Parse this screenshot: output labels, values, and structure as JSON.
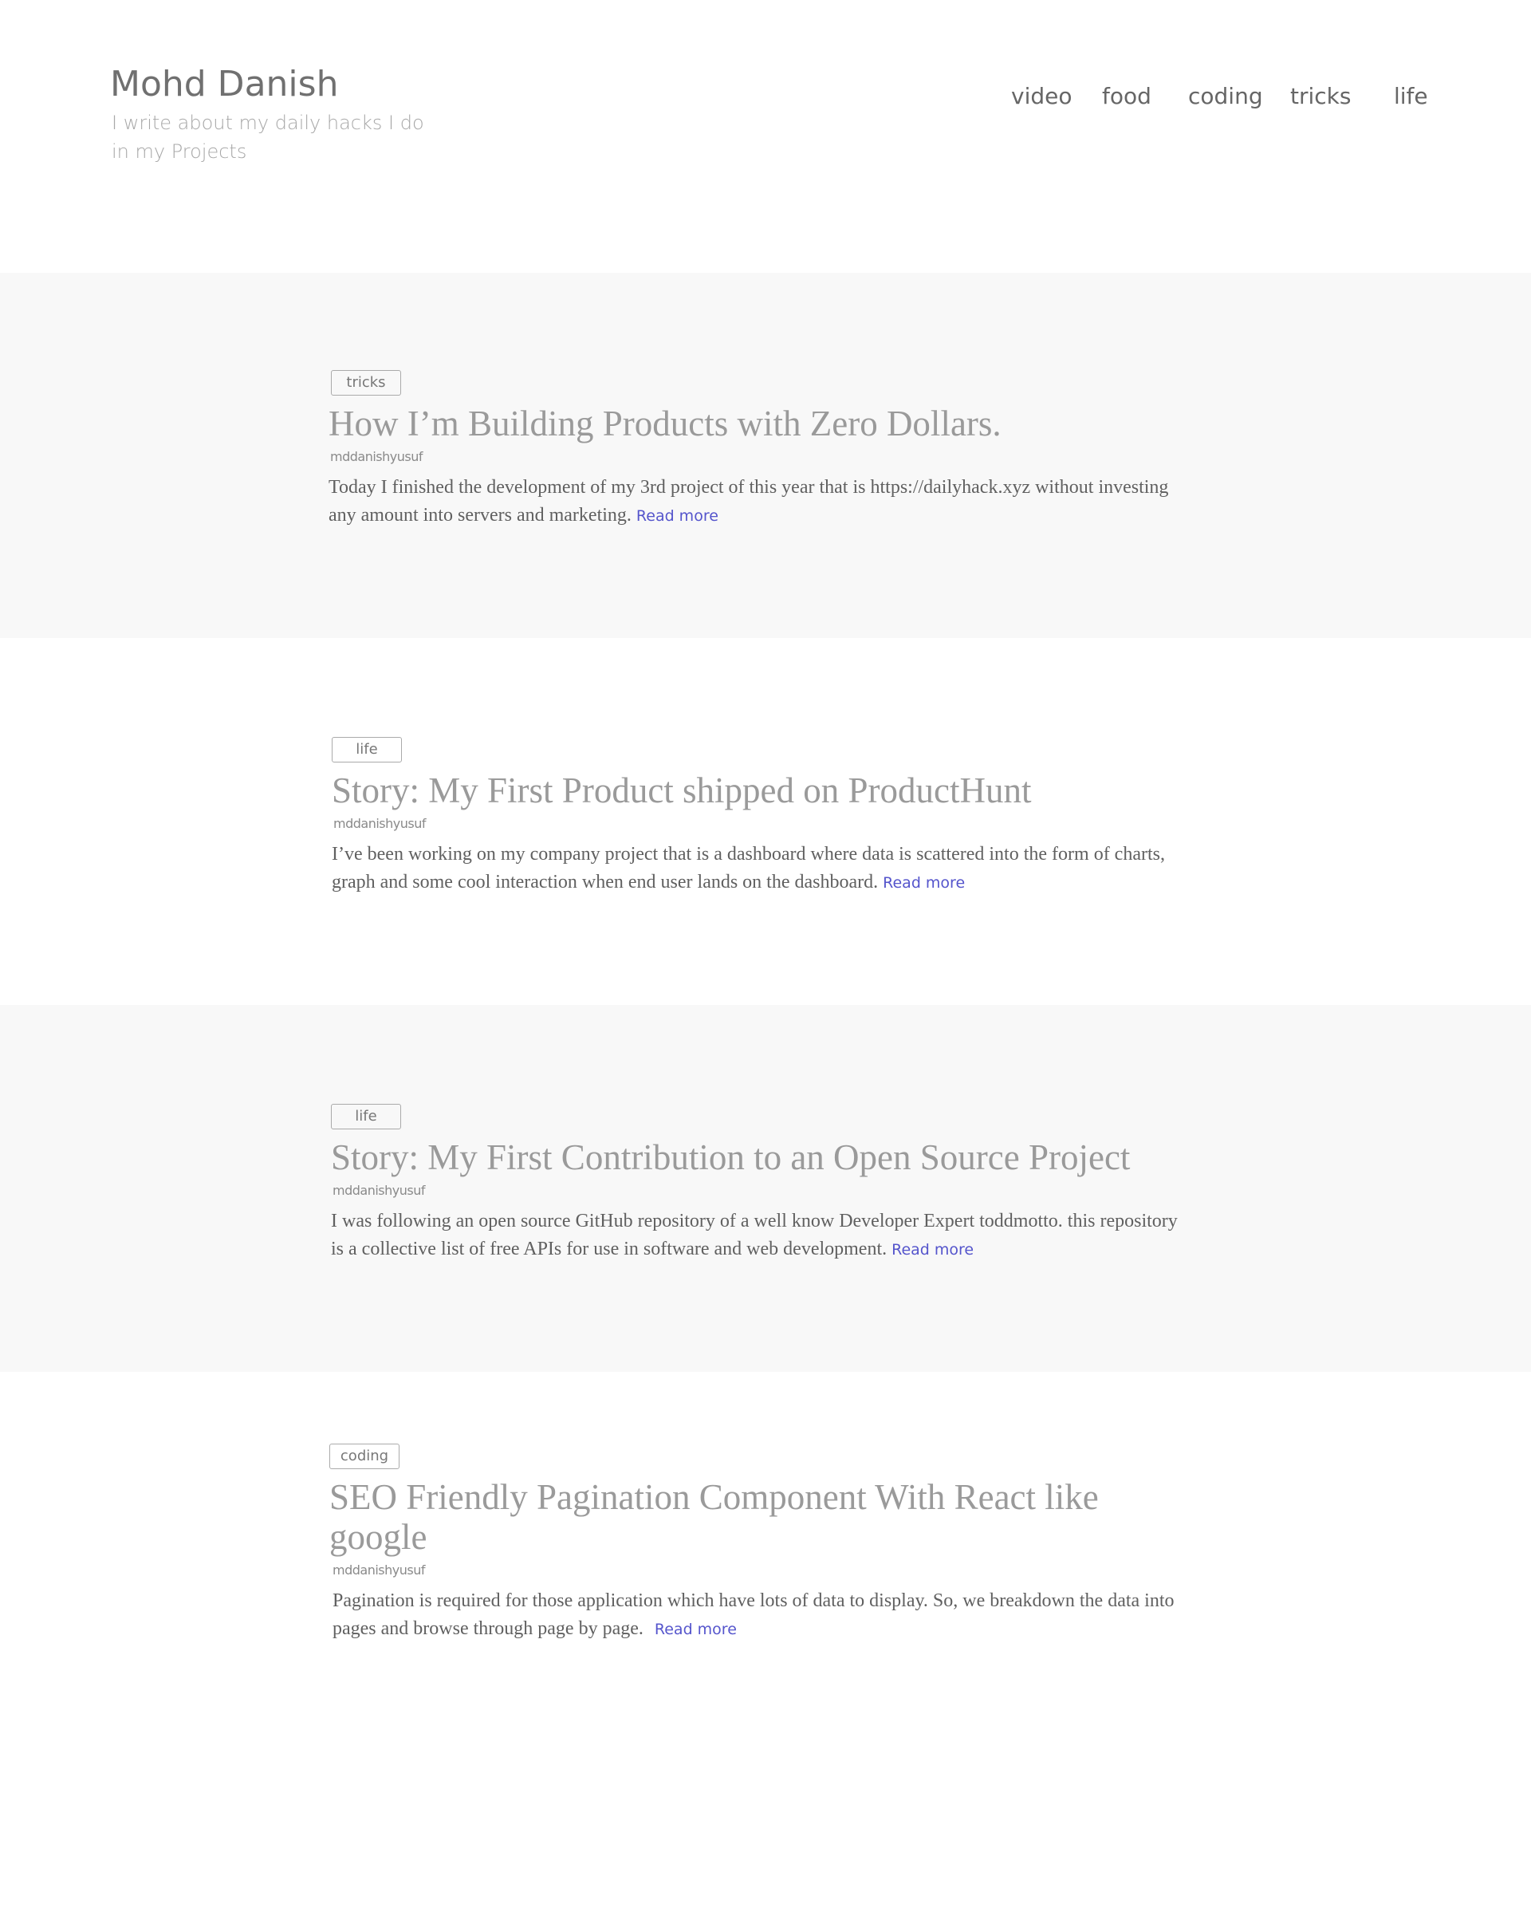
{
  "site": {
    "title": "Mohd Danish",
    "tagline": "I write about my daily hacks I do in my Projects"
  },
  "nav": {
    "items": [
      "video",
      "food",
      "coding",
      "tricks",
      "life"
    ]
  },
  "posts": [
    {
      "category": "tricks",
      "title": "How I’m Building Products with Zero Dollars.",
      "author": "mddanishyusuf",
      "excerpt": "Today I finished the development of my 3rd project of this year that is https://dailyhack.xyz without investing any amount into servers and marketing.",
      "read_more": "Read more"
    },
    {
      "category": "life",
      "title": "Story: My First Product shipped on ProductHunt",
      "author": "mddanishyusuf",
      "excerpt": "I’ve been working on my company project that is a dashboard where data is scattered into the form of charts, graph and some cool interaction when end user lands on the dashboard.",
      "read_more": "Read more"
    },
    {
      "category": "life",
      "title": "Story: My First Contribution to an Open Source Project",
      "author": "mddanishyusuf",
      "excerpt": "I was following an open source GitHub repository of a well know Developer Expert toddmotto. this repository is a collective list of free APIs for use in software and web development.",
      "read_more": "Read more"
    },
    {
      "category": "coding",
      "title": "SEO Friendly Pagination Component With React like google",
      "author": "mddanishyusuf",
      "excerpt": "Pagination is required for those application which have lots of data to display. So, we breakdown the data into pages and browse through page by page.",
      "read_more": "Read more"
    }
  ],
  "colors": {
    "shaded_band": "#f8f8f8",
    "link": "#5555cc",
    "title": "#9a9a9a"
  }
}
